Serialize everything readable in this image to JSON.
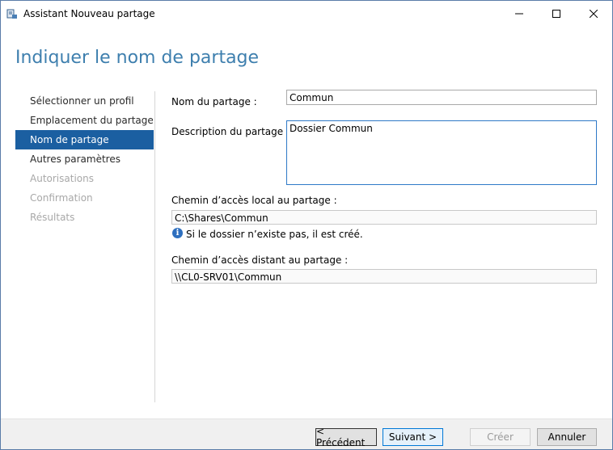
{
  "window": {
    "title": "Assistant Nouveau partage"
  },
  "page": {
    "heading": "Indiquer le nom de partage"
  },
  "nav": {
    "items": [
      {
        "label": "Sélectionner un profil",
        "state": "normal"
      },
      {
        "label": "Emplacement du partage",
        "state": "normal"
      },
      {
        "label": "Nom de partage",
        "state": "active"
      },
      {
        "label": "Autres paramètres",
        "state": "normal"
      },
      {
        "label": "Autorisations",
        "state": "disabled"
      },
      {
        "label": "Confirmation",
        "state": "disabled"
      },
      {
        "label": "Résultats",
        "state": "disabled"
      }
    ]
  },
  "form": {
    "share_name_label": "Nom du partage :",
    "share_name_value": "Commun",
    "description_label": "Description du partage :",
    "description_value": "Dossier Commun",
    "local_path_label": "Chemin d’accès local au partage :",
    "local_path_value": "C:\\Shares\\Commun",
    "info_text": "Si le dossier n’existe pas, il est créé.",
    "remote_path_label": "Chemin d’accès distant au partage :",
    "remote_path_value": "\\\\CL0-SRV01\\Commun"
  },
  "buttons": {
    "previous": "< Précédent",
    "next": "Suivant >",
    "create": "Créer",
    "cancel": "Annuler"
  },
  "colors": {
    "heading": "#3e7fae",
    "nav_active": "#1b5fa1",
    "primary_button_border": "#0078d7"
  }
}
